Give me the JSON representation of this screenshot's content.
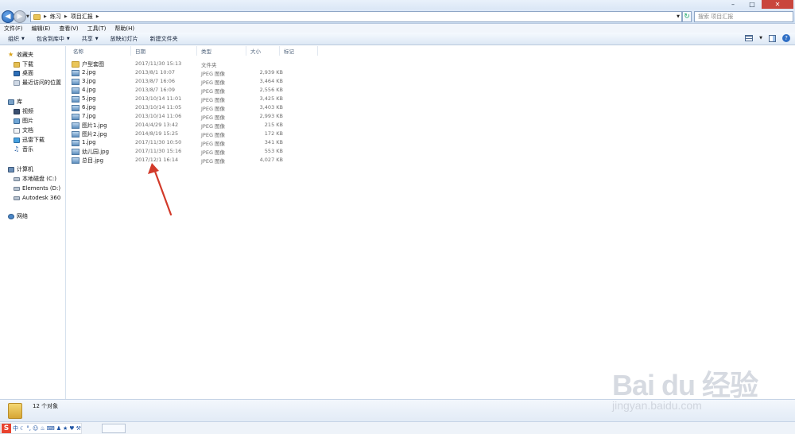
{
  "address": {
    "crumbs": [
      "练习",
      "项目汇报"
    ],
    "search_placeholder": "搜索 项目汇报"
  },
  "menu": [
    "文件(F)",
    "编辑(E)",
    "查看(V)",
    "工具(T)",
    "帮助(H)"
  ],
  "toolbar": {
    "organize": "组织",
    "include": "包含到库中",
    "share": "共享",
    "slideshow": "放映幻灯片",
    "new_folder": "新建文件夹"
  },
  "sidebar": {
    "favorites": "收藏夹",
    "downloads": "下载",
    "desktop": "桌面",
    "recent": "最近访问的位置",
    "libraries": "库",
    "videos": "视频",
    "pictures": "图片",
    "documents": "文档",
    "xunlei": "迅雷下载",
    "music": "音乐",
    "computer": "计算机",
    "local_disk": "本地磁盘 (C:)",
    "elements": "Elements (D:)",
    "autodesk": "Autodesk 360",
    "network": "网络"
  },
  "columns": {
    "name": "名称",
    "date": "日期",
    "type": "类型",
    "size": "大小",
    "tags": "标记"
  },
  "files": [
    {
      "name": "户型套图",
      "date": "2017/11/30 15:13",
      "type": "文件夹",
      "size": "",
      "icon": "folder"
    },
    {
      "name": "2.jpg",
      "date": "2013/8/1 10:07",
      "type": "JPEG 图像",
      "size": "2,939 KB",
      "icon": "jpg"
    },
    {
      "name": "3.jpg",
      "date": "2013/8/7 16:06",
      "type": "JPEG 图像",
      "size": "3,464 KB",
      "icon": "jpg"
    },
    {
      "name": "4.jpg",
      "date": "2013/8/7 16:09",
      "type": "JPEG 图像",
      "size": "2,556 KB",
      "icon": "jpg"
    },
    {
      "name": "5.jpg",
      "date": "2013/10/14 11:01",
      "type": "JPEG 图像",
      "size": "3,425 KB",
      "icon": "jpg"
    },
    {
      "name": "6.jpg",
      "date": "2013/10/14 11:05",
      "type": "JPEG 图像",
      "size": "3,403 KB",
      "icon": "jpg"
    },
    {
      "name": "7.jpg",
      "date": "2013/10/14 11:06",
      "type": "JPEG 图像",
      "size": "2,993 KB",
      "icon": "jpg"
    },
    {
      "name": "图片1.jpg",
      "date": "2014/4/29 13:42",
      "type": "JPEG 图像",
      "size": "215 KB",
      "icon": "jpg"
    },
    {
      "name": "图片2.jpg",
      "date": "2014/8/19 15:25",
      "type": "JPEG 图像",
      "size": "172 KB",
      "icon": "jpg"
    },
    {
      "name": "1.jpg",
      "date": "2017/11/30 10:50",
      "type": "JPEG 图像",
      "size": "341 KB",
      "icon": "jpg"
    },
    {
      "name": "幼儿园.jpg",
      "date": "2017/11/30 15:16",
      "type": "JPEG 图像",
      "size": "553 KB",
      "icon": "jpg"
    },
    {
      "name": "总目.jpg",
      "date": "2017/12/1 16:14",
      "type": "JPEG 图像",
      "size": "4,027 KB",
      "icon": "jpg"
    }
  ],
  "status": {
    "count": "12 个对象"
  },
  "ime": {
    "mode": "中"
  },
  "watermark": {
    "brand": "Bai du 经验",
    "url": "jingyan.baidu.com"
  },
  "colors": {
    "annotation_arrow": "#d23a2a",
    "close_button": "#c9463d"
  }
}
